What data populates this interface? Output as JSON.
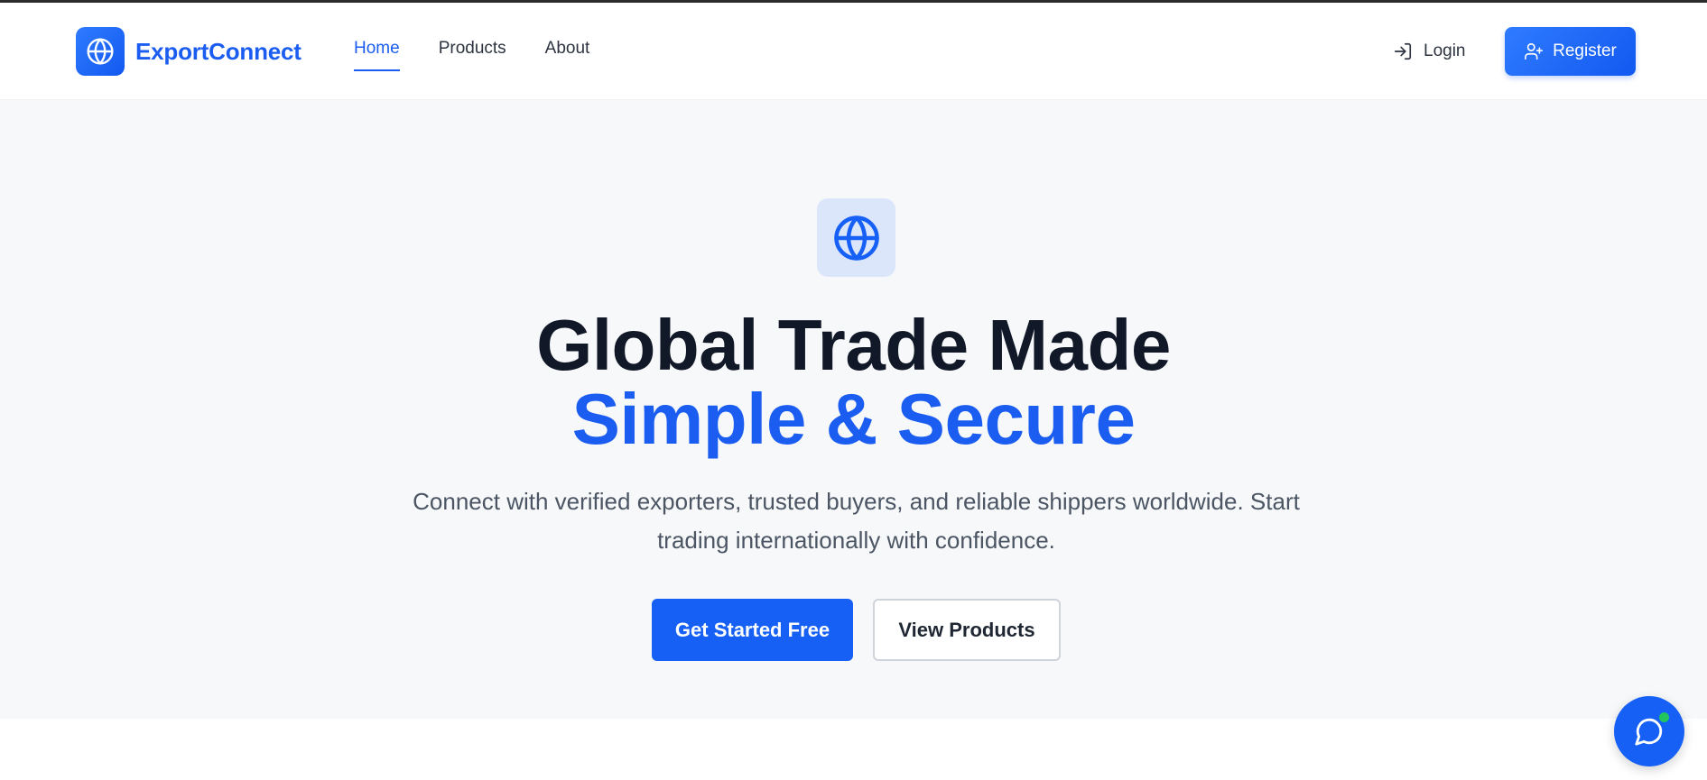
{
  "brand": {
    "name": "ExportConnect",
    "icon": "globe-icon",
    "color": "#1a5df0"
  },
  "nav": {
    "items": [
      {
        "label": "Home",
        "active": true
      },
      {
        "label": "Products",
        "active": false
      },
      {
        "label": "About",
        "active": false
      }
    ]
  },
  "auth": {
    "login_label": "Login",
    "login_icon": "log-in-icon",
    "register_label": "Register",
    "register_icon": "user-plus-icon"
  },
  "hero": {
    "icon": "globe-icon",
    "title_line1": "Global Trade Made",
    "title_line2": "Simple & Secure",
    "subtitle": "Connect with verified exporters, trusted buyers, and reliable shippers worldwide. Start trading internationally with confidence.",
    "primary_cta": "Get Started Free",
    "secondary_cta": "View Products"
  },
  "chat": {
    "icon": "chat-bubble-icon",
    "status": "online",
    "status_color": "#22c55e"
  },
  "colors": {
    "accent": "#1660f5",
    "heading": "#111827",
    "body_text": "#4b5563",
    "hero_bg": "#f7f8fa"
  }
}
